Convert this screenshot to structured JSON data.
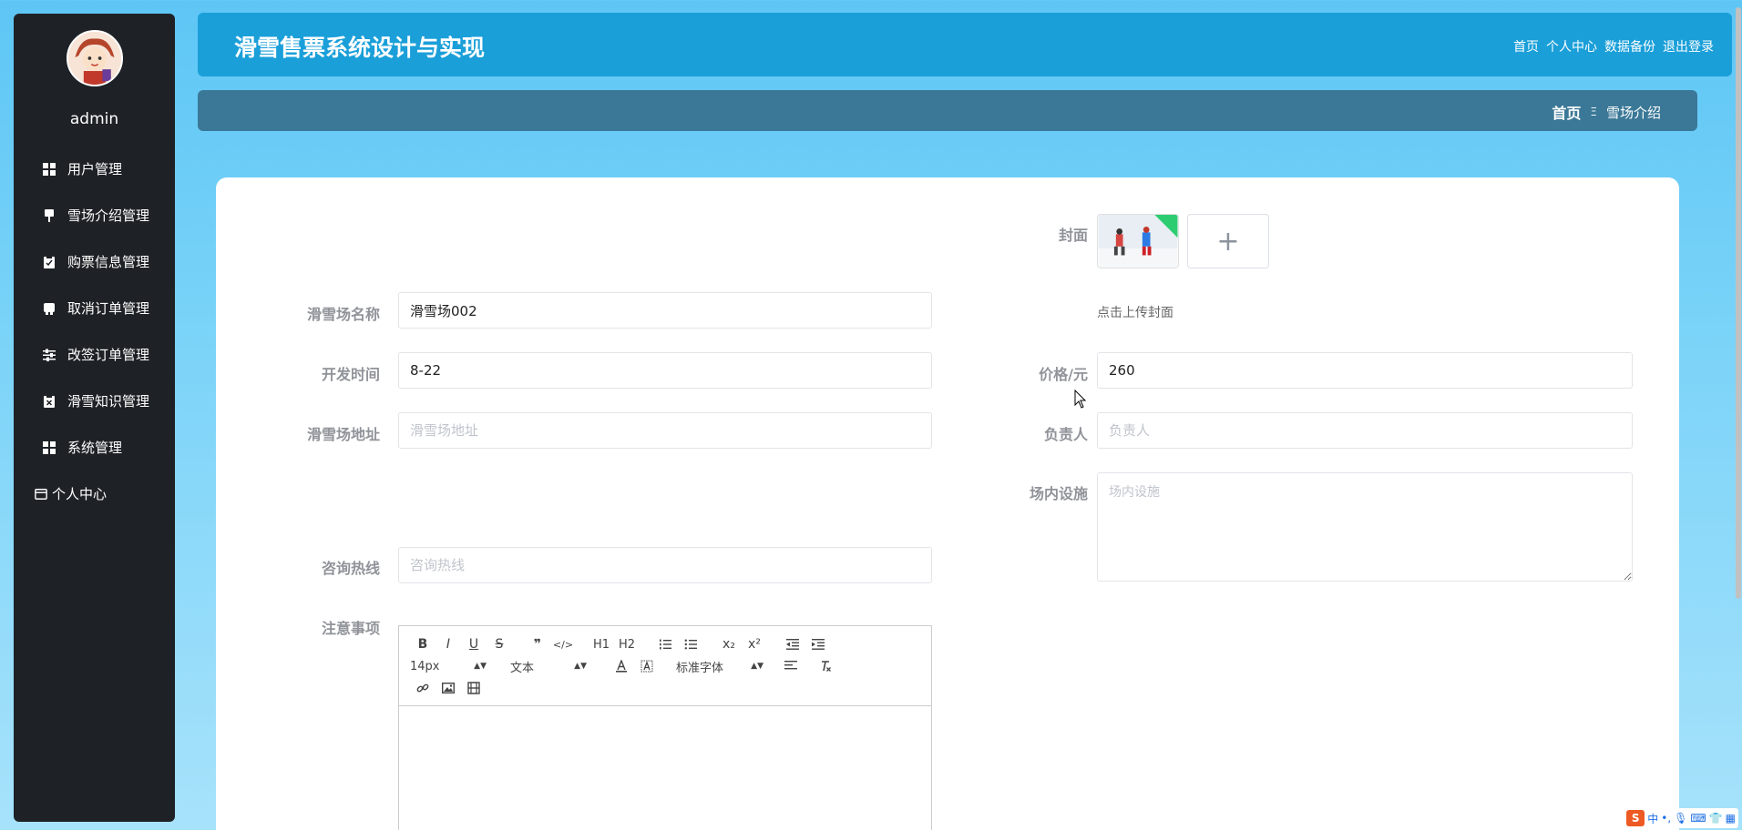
{
  "sidebar": {
    "username": "admin",
    "items": [
      {
        "label": "用户管理",
        "icon": "grid-icon"
      },
      {
        "label": "雪场介绍管理",
        "icon": "pin-icon"
      },
      {
        "label": "购票信息管理",
        "icon": "clipboard-icon"
      },
      {
        "label": "取消订单管理",
        "icon": "card-icon"
      },
      {
        "label": "改签订单管理",
        "icon": "sliders-icon"
      },
      {
        "label": "滑雪知识管理",
        "icon": "clipboard-x-icon"
      },
      {
        "label": "系统管理",
        "icon": "grid-icon"
      },
      {
        "label": "个人中心",
        "icon": "wallet-icon"
      }
    ]
  },
  "header": {
    "title": "滑雪售票系统设计与实现",
    "nav": [
      "首页",
      "个人中心",
      "数据备份",
      "退出登录"
    ]
  },
  "breadcrumb": {
    "home": "首页",
    "separator": "Ξ",
    "current": "雪场介绍"
  },
  "form": {
    "cover_label": "封面",
    "cover_hint": "点击上传封面",
    "upload_plus": "+",
    "name": {
      "label": "滑雪场名称",
      "value": "滑雪场002",
      "placeholder": "滑雪场名称"
    },
    "open_time": {
      "label": "开发时间",
      "value": "8-22",
      "placeholder": "开发时间"
    },
    "price": {
      "label": "价格/元",
      "value": "260",
      "placeholder": "价格/元"
    },
    "address": {
      "label": "滑雪场地址",
      "value": "",
      "placeholder": "滑雪场地址"
    },
    "manager": {
      "label": "负责人",
      "value": "",
      "placeholder": "负责人"
    },
    "facilities": {
      "label": "场内设施",
      "value": "",
      "placeholder": "场内设施"
    },
    "hotline": {
      "label": "咨询热线",
      "value": "",
      "placeholder": "咨询热线"
    },
    "notes": {
      "label": "注意事项"
    }
  },
  "editor": {
    "font_size": "14px",
    "block_type": "文本",
    "font_family": "标准字体",
    "buttons_row1": [
      "B",
      "I",
      "U",
      "S",
      "❞",
      "</>",
      "H1",
      "H2",
      "ol",
      "ul",
      "x₂",
      "x²",
      "outdent",
      "indent"
    ]
  },
  "ime": {
    "logo": "S",
    "mode": "中",
    "punct": "•,"
  },
  "colors": {
    "header_bg": "#1a9fd9",
    "crumb_bg": "#3b7897",
    "sidebar_bg": "#1e2226"
  }
}
